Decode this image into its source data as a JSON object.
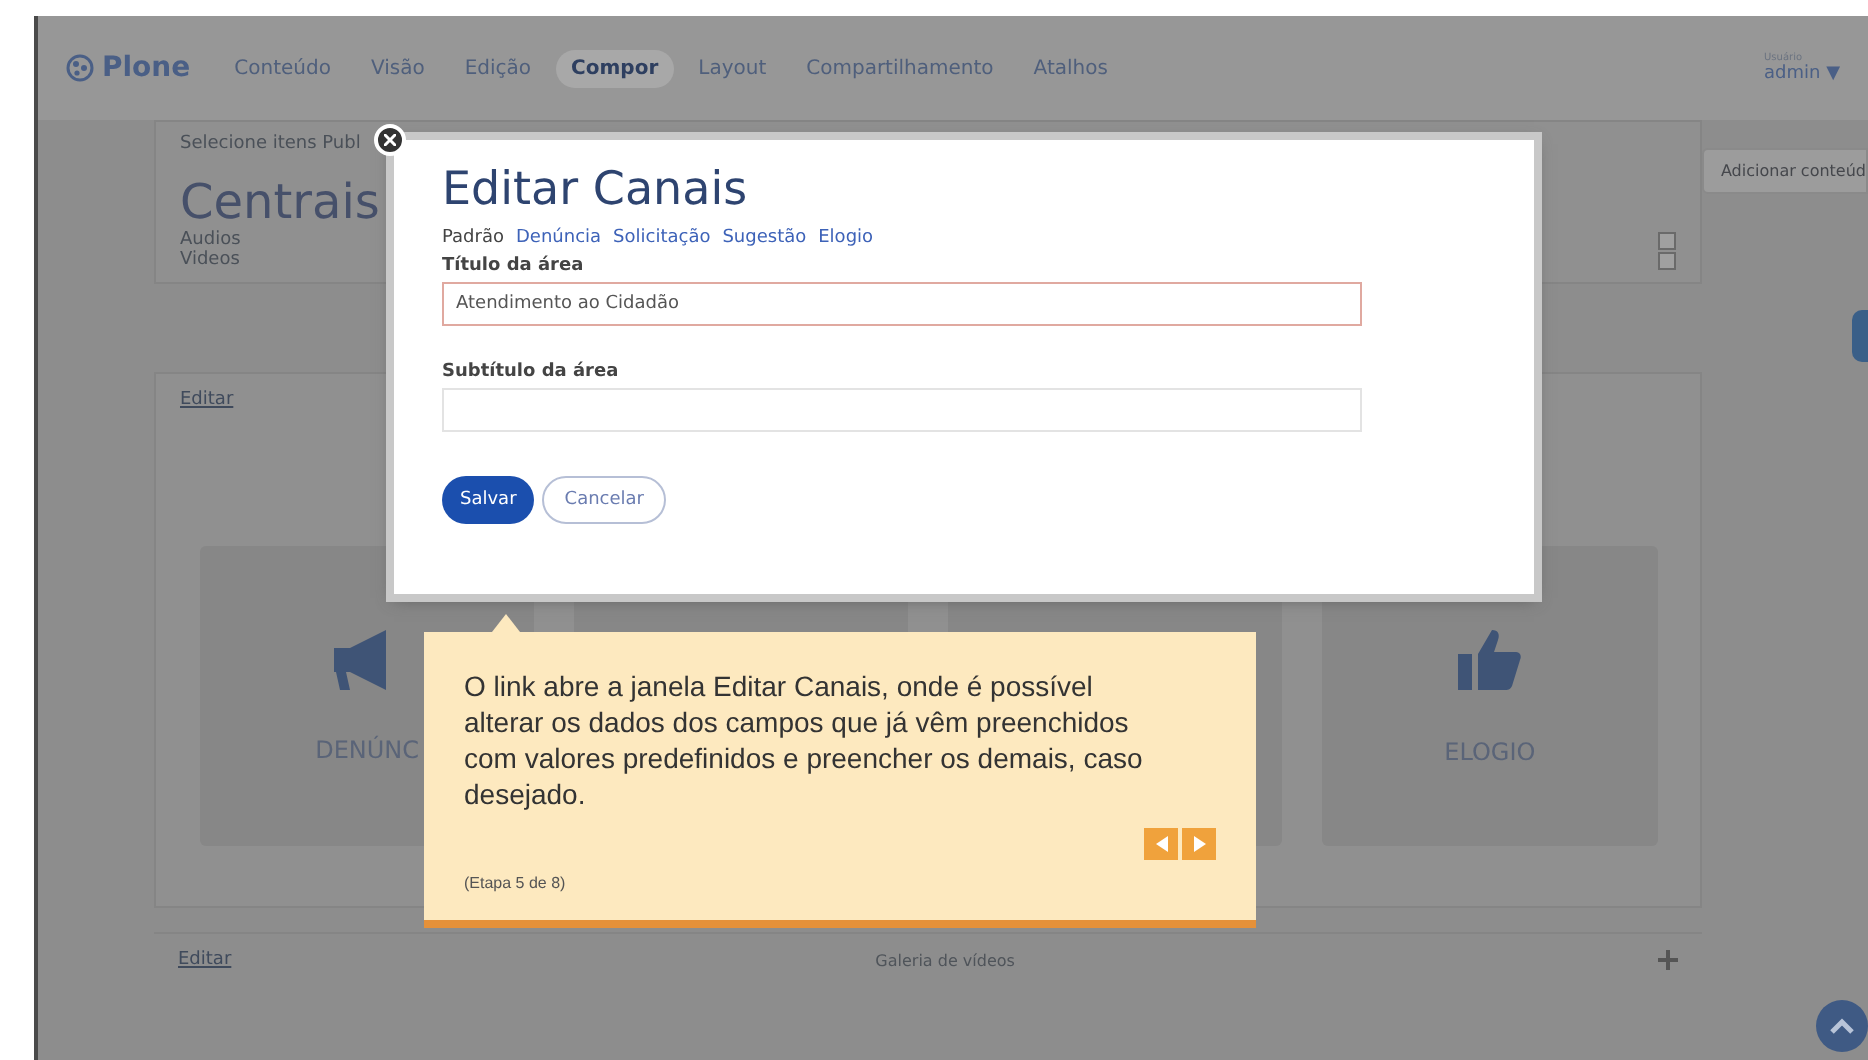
{
  "toolbar": {
    "logo": "Plone",
    "menu": [
      {
        "label": "Conteúdo",
        "selected": false
      },
      {
        "label": "Visão",
        "selected": false
      },
      {
        "label": "Edição",
        "selected": false
      },
      {
        "label": "Compor",
        "selected": true
      },
      {
        "label": "Layout",
        "selected": false
      },
      {
        "label": "Compartilhamento",
        "selected": false
      },
      {
        "label": "Atalhos",
        "selected": false
      }
    ],
    "user_label": "Usuário",
    "user": "admin ▼"
  },
  "page": {
    "selection_hint": "Selecione itens Publ",
    "heading": "Centrais",
    "items": [
      {
        "label": "Audios",
        "checked": false
      },
      {
        "label": "Videos",
        "checked": false
      }
    ],
    "add_button": "Adicionar conteúd",
    "edit_link": "Editar",
    "cards": [
      {
        "kind": "megaphone",
        "label": "DENÚNC"
      },
      {
        "kind": "covered"
      },
      {
        "kind": "covered"
      },
      {
        "kind": "thumbs-up",
        "label": "ELOGIO"
      }
    ],
    "gallery": {
      "edit_link": "Editar",
      "title": "Galeria de vídeos"
    }
  },
  "modal": {
    "title": "Editar Canais",
    "tabs": [
      {
        "label": "Padrão",
        "selected": true
      },
      {
        "label": "Denúncia",
        "selected": false
      },
      {
        "label": "Solicitação",
        "selected": false
      },
      {
        "label": "Sugestão",
        "selected": false
      },
      {
        "label": "Elogio",
        "selected": false
      }
    ],
    "fields": [
      {
        "label": "Título da área",
        "value": "Atendimento ao Cidadão",
        "invalid": true
      },
      {
        "label": "Subtítulo da área",
        "invalid": false
      }
    ],
    "save": "Salvar",
    "cancel": "Cancelar"
  },
  "tour": {
    "text": "O link abre a janela Editar Canais, onde é possível alterar os dados dos campos que já vêm preenchidos com valores predefinidos e preencher os demais, caso desejado.",
    "step": "(Etapa 5 de 8)"
  }
}
